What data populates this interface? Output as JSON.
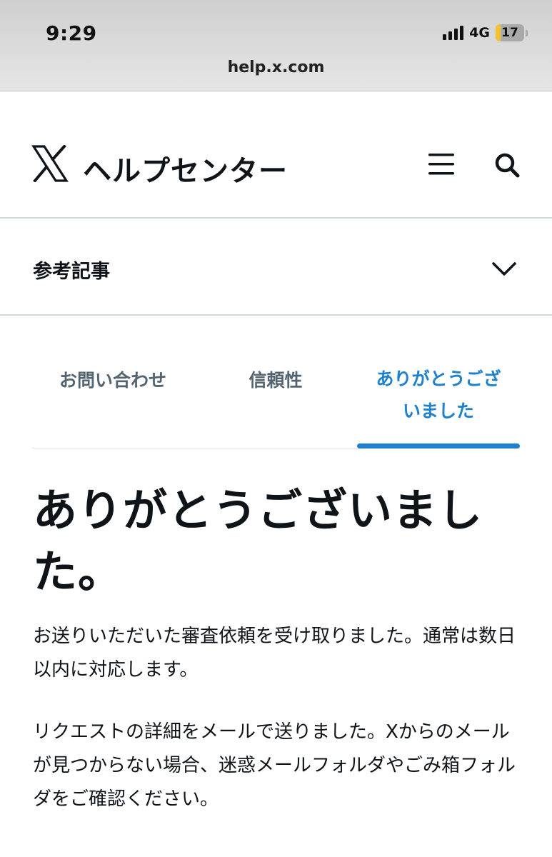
{
  "status_bar": {
    "time": "9:29",
    "network": "4G",
    "battery_level": "17",
    "battery_fraction": 0.17
  },
  "browser": {
    "url": "help.x.com"
  },
  "header": {
    "logo_icon": "x-logo-icon",
    "title": "ヘルプセンター",
    "menu_icon": "hamburger-menu-icon",
    "search_icon": "search-icon"
  },
  "related": {
    "label": "参考記事",
    "icon": "chevron-down-icon"
  },
  "tabs": [
    {
      "label": "お問い合わせ",
      "active": false
    },
    {
      "label": "信頼性",
      "active": false
    },
    {
      "label": "ありがとうございました",
      "active": true
    }
  ],
  "colors": {
    "accent": "#1d80d0",
    "text": "#0f1419",
    "muted": "#536471",
    "divider": "#cfd9de",
    "battery_low": "#f2c230"
  },
  "main": {
    "title": "ありがとうございました。",
    "paragraphs": [
      "お送りいただいた審査依頼を受け取りました。通常は数日以内に対応します。",
      "リクエストの詳細をメールで送りました。Xからのメールが見つからない場合、迷惑メールフォルダやごみ箱フォルダをご確認ください。"
    ]
  }
}
